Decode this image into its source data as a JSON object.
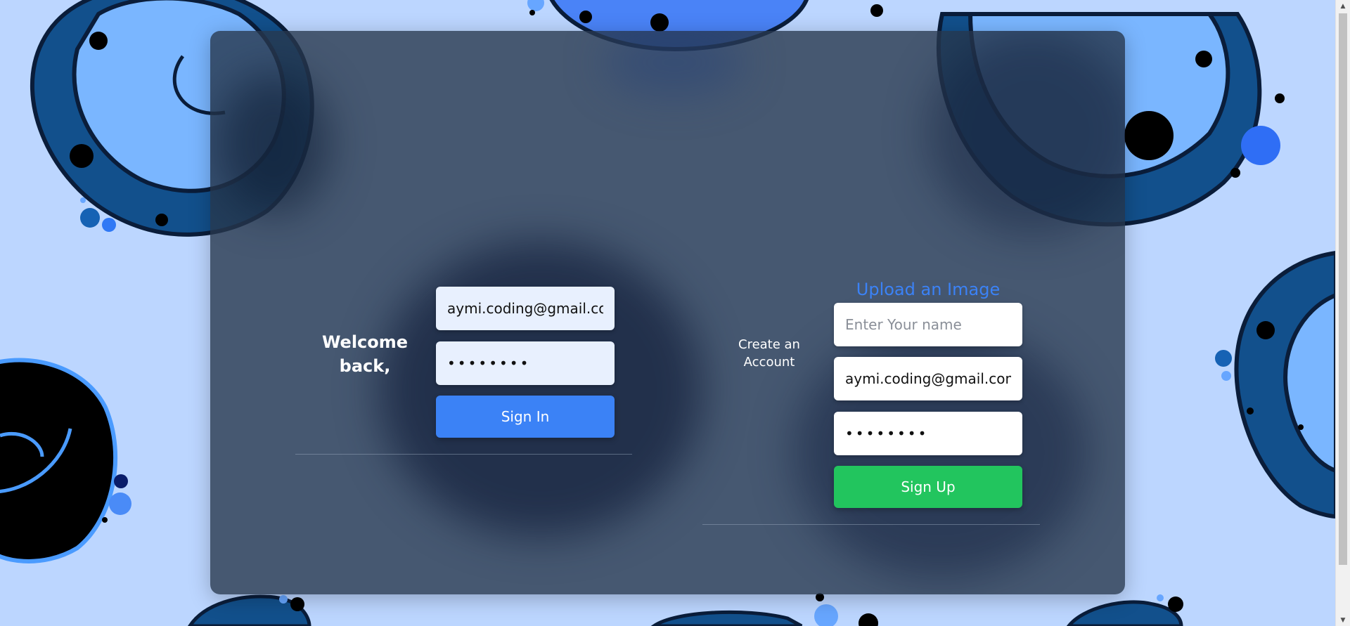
{
  "sign_in": {
    "welcome_line1": "Welcome",
    "welcome_line2": "back,",
    "email_value": "aymi.coding@gmail.com",
    "password_value": "••••••••",
    "button_label": "Sign In"
  },
  "sign_up": {
    "upload_title": "Upload an Image",
    "create_line1": "Create an",
    "create_line2": "Account",
    "name_placeholder": "Enter Your name",
    "email_value": "aymi.coding@gmail.com",
    "password_value": "••••••••",
    "button_label": "Sign Up"
  },
  "colors": {
    "page_background": "#bcd6ff",
    "card": "#28384e",
    "sign_in_button": "#3b82f6",
    "sign_up_button": "#22c55e",
    "upload_title": "#3b82f6"
  }
}
